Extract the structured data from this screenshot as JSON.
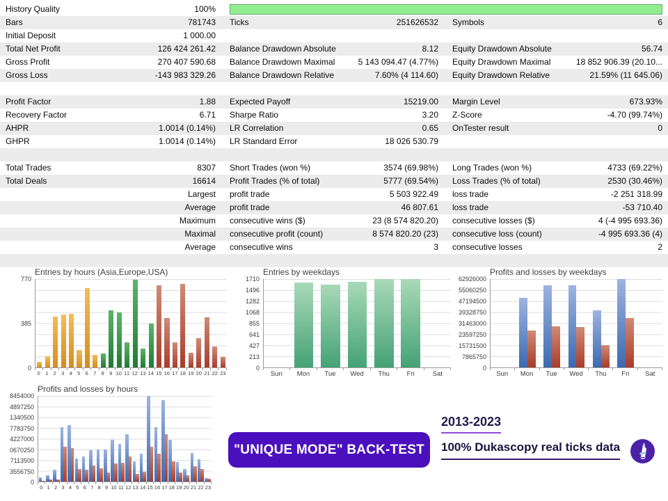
{
  "colors": {
    "accent_purple": "#4a10bd",
    "progress_green": "#90ee90",
    "row_shade": "#ececec",
    "bars": {
      "orange": {
        "top": "#f2bd5d",
        "bottom": "#d88c1a"
      },
      "green": {
        "top": "#5cb468",
        "bottom": "#1e7d33"
      },
      "green2": {
        "top": "#a9d9b8",
        "bottom": "#46a276"
      },
      "blue": {
        "top": "#9db4e0",
        "bottom": "#3c69b0"
      },
      "red": {
        "top": "#d08a76",
        "bottom": "#a93c2b"
      }
    }
  },
  "stats": {
    "rows": [
      {
        "c1l": "History Quality",
        "c1v": "100%",
        "progress": true
      },
      {
        "c1l": "Bars",
        "c1v": "781743",
        "c2l": "Ticks",
        "c2v": "251626532",
        "c3l": "Symbols",
        "c3v": "6"
      },
      {
        "c1l": "Initial Deposit",
        "c1v": "1 000.00",
        "c2l": "",
        "c2v": "",
        "c3l": "",
        "c3v": ""
      },
      {
        "c1l": "Total Net Profit",
        "c1v": "126 424 261.42",
        "c2l": "Balance Drawdown Absolute",
        "c2v": "8.12",
        "c3l": "Equity Drawdown Absolute",
        "c3v": "56.74"
      },
      {
        "c1l": "Gross Profit",
        "c1v": "270 407 590.68",
        "c2l": "Balance Drawdown Maximal",
        "c2v": "5 143 094.47 (4.77%)",
        "c3l": "Equity Drawdown Maximal",
        "c3v": "18 852 906.39 (20.10..."
      },
      {
        "c1l": "Gross Loss",
        "c1v": "-143 983 329.26",
        "c2l": "Balance Drawdown Relative",
        "c2v": "7.60% (4 114.60)",
        "c3l": "Equity Drawdown Relative",
        "c3v": "21.59% (11 645.06)"
      },
      {
        "gap": true
      },
      {
        "c1l": "Profit Factor",
        "c1v": "1.88",
        "c2l": "Expected Payoff",
        "c2v": "15219.00",
        "c3l": "Margin Level",
        "c3v": "673.93%"
      },
      {
        "c1l": "Recovery Factor",
        "c1v": "6.71",
        "c2l": "Sharpe Ratio",
        "c2v": "3.20",
        "c3l": "Z-Score",
        "c3v": "-4.70 (99.74%)"
      },
      {
        "c1l": "AHPR",
        "c1v": "1.0014 (0.14%)",
        "c2l": "LR Correlation",
        "c2v": "0.65",
        "c3l": "OnTester result",
        "c3v": "0"
      },
      {
        "c1l": "GHPR",
        "c1v": "1.0014 (0.14%)",
        "c2l": "LR Standard Error",
        "c2v": "18 026 530.79",
        "c3l": "",
        "c3v": ""
      },
      {
        "gap": true
      },
      {
        "c1l": "Total Trades",
        "c1v": "8307",
        "c2l": "Short Trades (won %)",
        "c2v": "3574 (69.98%)",
        "c3l": "Long Trades (won %)",
        "c3v": "4733 (69.22%)"
      },
      {
        "c1l": "Total Deals",
        "c1v": "16614",
        "c2l": "Profit Trades (% of total)",
        "c2v": "5777 (69.54%)",
        "c3l": "Loss Trades (% of total)",
        "c3v": "2530 (30.46%)"
      },
      {
        "c1l": "",
        "c1v": "Largest",
        "c2l": "profit trade",
        "c2v": "5 503 922.49",
        "c3l": "loss trade",
        "c3v": "-2 251 318.99"
      },
      {
        "c1l": "",
        "c1v": "Average",
        "c2l": "profit trade",
        "c2v": "46 807.61",
        "c3l": "loss trade",
        "c3v": "-53 710.40"
      },
      {
        "c1l": "",
        "c1v": "Maximum",
        "c2l": "consecutive wins ($)",
        "c2v": "23 (8 574 820.20)",
        "c3l": "consecutive losses ($)",
        "c3v": "4 (-4 995 693.36)"
      },
      {
        "c1l": "",
        "c1v": "Maximal",
        "c2l": "consecutive profit (count)",
        "c2v": "8 574 820.20 (23)",
        "c3l": "consecutive loss (count)",
        "c3v": "-4 995 693.36 (4)"
      },
      {
        "c1l": "",
        "c1v": "Average",
        "c2l": "consecutive wins",
        "c2v": "3",
        "c3l": "consecutive losses",
        "c3v": "2"
      },
      {
        "gap": true
      }
    ]
  },
  "chart_data": [
    {
      "type": "bar",
      "title": "Entries by hours (Asia,Europe,USA)",
      "categories": [
        "0",
        "1",
        "2",
        "3",
        "4",
        "5",
        "6",
        "7",
        "8",
        "9",
        "10",
        "11",
        "12",
        "13",
        "14",
        "15",
        "16",
        "17",
        "18",
        "19",
        "20",
        "21",
        "22",
        "23"
      ],
      "values": [
        50,
        100,
        445,
        460,
        465,
        150,
        690,
        110,
        120,
        495,
        480,
        220,
        765,
        165,
        385,
        715,
        430,
        220,
        725,
        130,
        255,
        435,
        185,
        90
      ],
      "bar_groups": [
        "orange",
        "orange",
        "orange",
        "orange",
        "orange",
        "orange",
        "orange",
        "orange",
        "green",
        "green",
        "green",
        "green",
        "green",
        "green",
        "green",
        "red",
        "red",
        "red",
        "red",
        "red",
        "red",
        "red",
        "red",
        "red"
      ],
      "ylabels": [
        "770",
        "385",
        "0"
      ],
      "ylim": [
        0,
        770
      ],
      "xlabel": "",
      "ylabel": "",
      "grid": true,
      "legend": "none"
    },
    {
      "type": "bar",
      "title": "Entries by weekdays",
      "categories": [
        "Sun",
        "Mon",
        "Tue",
        "Wed",
        "Thu",
        "Fri",
        "Sat"
      ],
      "values": [
        0,
        1640,
        1600,
        1655,
        1710,
        1708,
        0
      ],
      "bar_groups": [
        "green2",
        "green2",
        "green2",
        "green2",
        "green2",
        "green2",
        "green2"
      ],
      "ylabels": [
        "1710",
        "1496",
        "1282",
        "1068",
        "855",
        "641",
        "427",
        "213",
        "0"
      ],
      "ylim": [
        0,
        1710
      ],
      "xlabel": "",
      "ylabel": "",
      "grid": true,
      "legend": "none"
    },
    {
      "type": "bar",
      "title": "Profits and losses by weekdays",
      "categories": [
        "Sun",
        "Mon",
        "Tue",
        "Wed",
        "Thu",
        "Fri",
        "Sat"
      ],
      "series": [
        {
          "name": "profits",
          "color": "blue",
          "values": [
            0,
            49700000,
            58600000,
            58700000,
            40700000,
            62900000,
            0
          ]
        },
        {
          "name": "losses",
          "color": "red",
          "values": [
            0,
            26200000,
            29000000,
            28700000,
            15700000,
            35300000,
            0
          ]
        }
      ],
      "ylabels": [
        "62926000",
        "55060250",
        "47194500",
        "39328750",
        "31463000",
        "23597250",
        "15731500",
        "7865750",
        "0"
      ],
      "ylim": [
        0,
        62926000
      ],
      "xlabel": "",
      "ylabel": "",
      "grid": true,
      "legend": "none"
    },
    {
      "type": "bar",
      "title": "Profits and losses by hours",
      "categories": [
        "0",
        "1",
        "2",
        "3",
        "4",
        "5",
        "6",
        "7",
        "8",
        "9",
        "10",
        "11",
        "12",
        "13",
        "14",
        "15",
        "16",
        "17",
        "18",
        "19",
        "20",
        "21",
        "22",
        "23"
      ],
      "series": [
        {
          "name": "profits",
          "color": "blue",
          "values": [
            1300000,
            2100000,
            3900000,
            18100000,
            18800000,
            7700000,
            8300000,
            10400000,
            10600000,
            10600000,
            13900000,
            12400000,
            15800000,
            6800000,
            9200000,
            28454000,
            18100000,
            27000000,
            13800000,
            6400000,
            4100000,
            9500000,
            7300000,
            1100000
          ]
        },
        {
          "name": "losses",
          "color": "red",
          "values": [
            250000,
            600000,
            750000,
            11600000,
            11000000,
            4200000,
            3900000,
            5300000,
            4400000,
            3000000,
            6000000,
            6300000,
            8400000,
            2600000,
            3200000,
            11600000,
            9300000,
            15700000,
            6700000,
            3100000,
            2000000,
            5000000,
            4200000,
            1000000
          ]
        }
      ],
      "ylabels": [
        "8454000",
        "4897250",
        "1340500",
        "7783750",
        "4227000",
        "0670250",
        "7113500",
        "3556750",
        "0"
      ],
      "ylim": [
        0,
        28454000
      ],
      "xlabel": "",
      "ylabel": "",
      "grid": true,
      "legend": "none"
    }
  ],
  "footer": {
    "banner": "\"UNIQUE MODE\" BACK-TEST",
    "period": "2013-2023",
    "datasource": "100% Dukascopy real ticks data"
  }
}
